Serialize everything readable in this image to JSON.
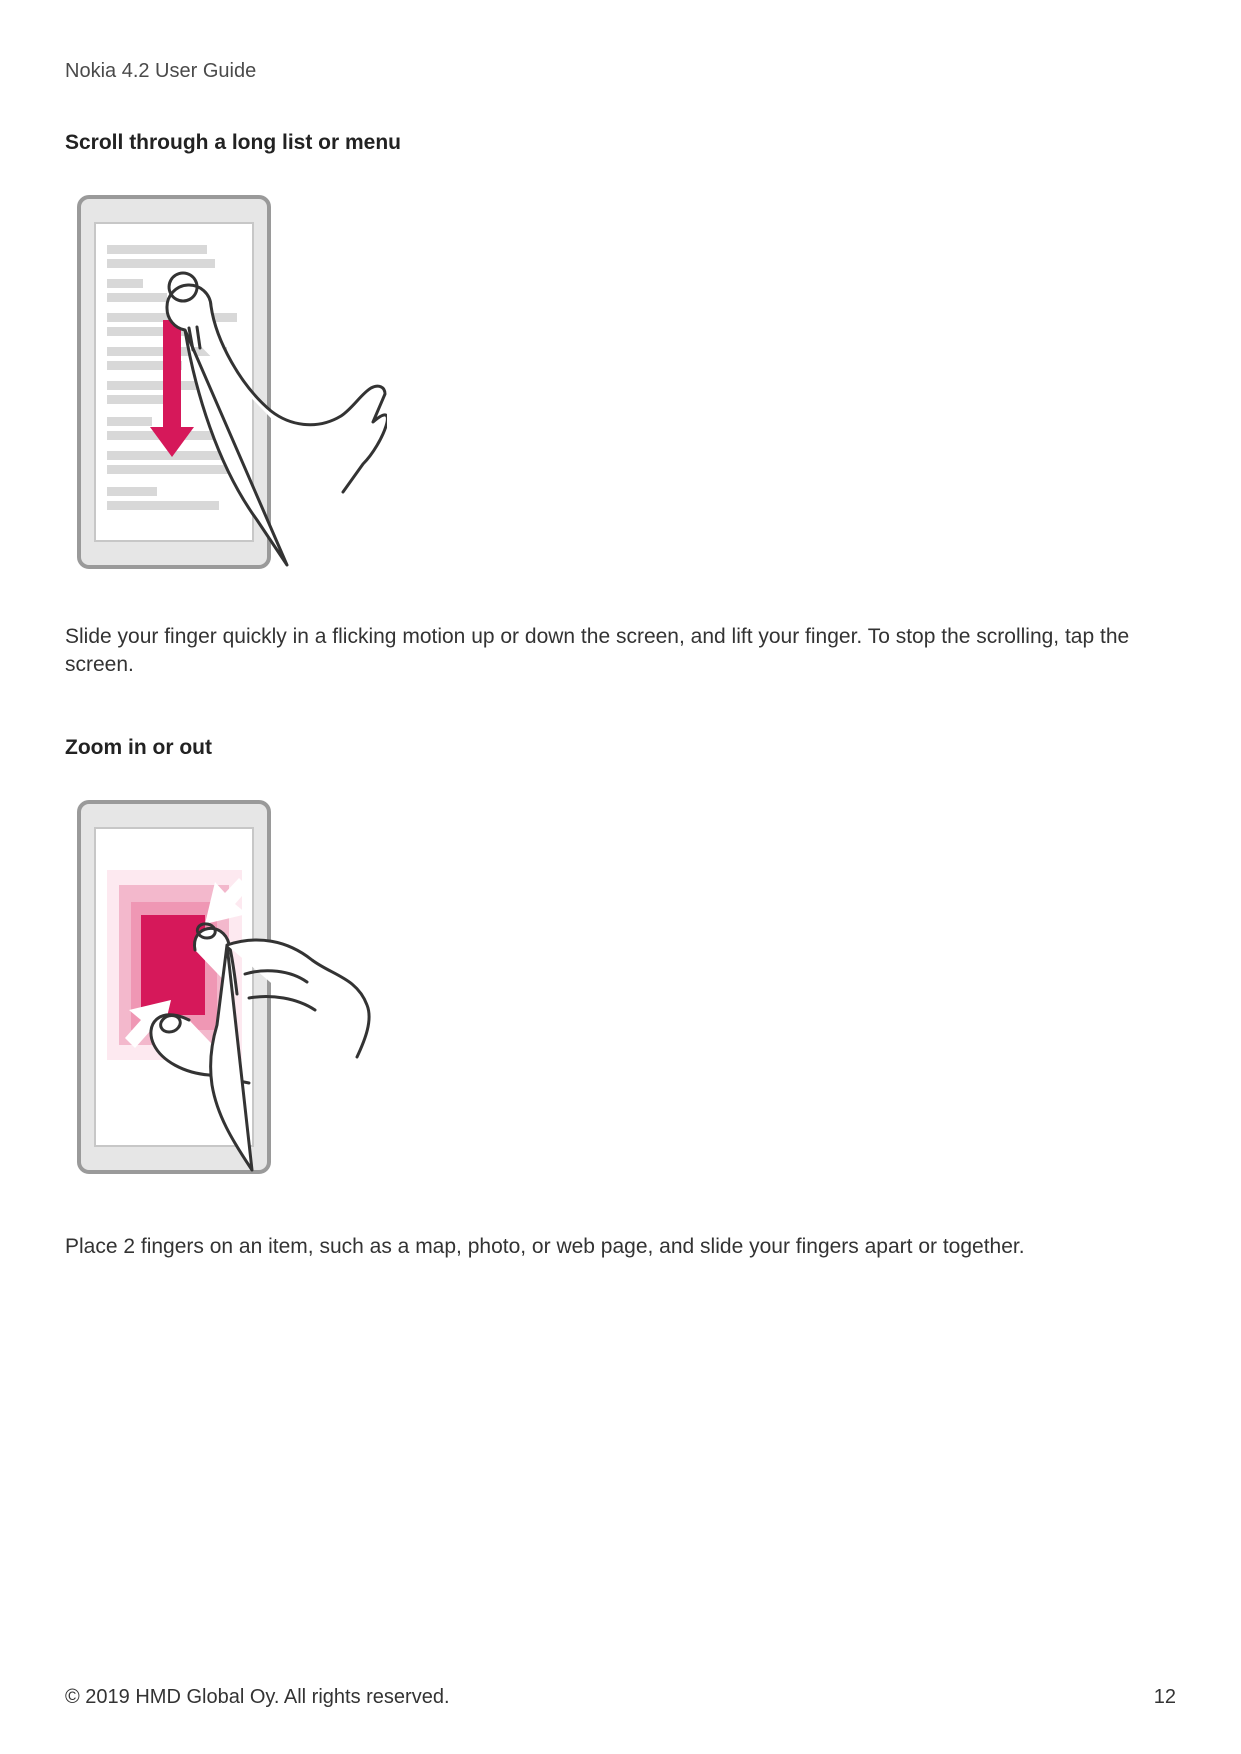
{
  "header": {
    "title": "Nokia 4.2 User Guide"
  },
  "sections": [
    {
      "title": "Scroll through a long list or menu",
      "body": "Slide your finger quickly in a flicking motion up or down the screen, and lift your finger. To stop the scrolling, tap the screen."
    },
    {
      "title": "Zoom in or out",
      "body": "Place 2 fingers on an item, such as a map, photo, or web page, and slide your fingers apart or together."
    }
  ],
  "footer": {
    "copyright": "© 2019 HMD Global Oy. All rights reserved.",
    "page": "12"
  },
  "colors": {
    "accent": "#d6185a",
    "accent_light": "#ef97b4"
  }
}
